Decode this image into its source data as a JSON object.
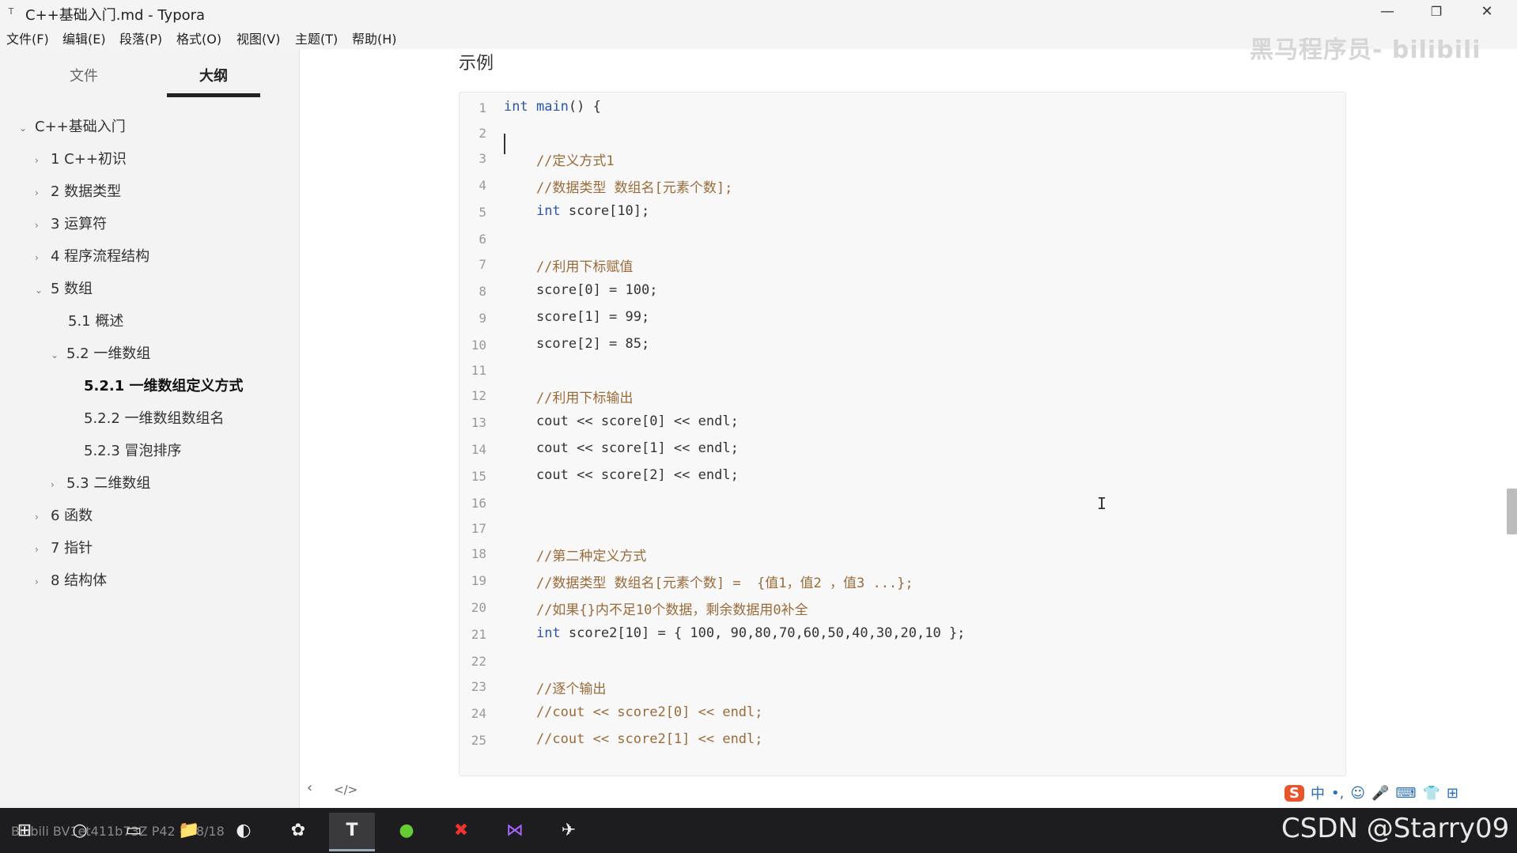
{
  "window": {
    "app_icon": "T",
    "title": "C++基础入门.md - Typora",
    "minimize": "—",
    "maximize": "❐",
    "close": "✕"
  },
  "menu": [
    "文件(F)",
    "编辑(E)",
    "段落(P)",
    "格式(O)",
    "视图(V)",
    "主题(T)",
    "帮助(H)"
  ],
  "sidebar": {
    "tabs": [
      "文件",
      "大纲"
    ],
    "toc": [
      {
        "label": "C++基础入门",
        "expanded": true
      },
      {
        "label": "1 C++初识",
        "expanded": false
      },
      {
        "label": "2 数据类型",
        "expanded": false
      },
      {
        "label": "3 运算符",
        "expanded": false
      },
      {
        "label": "4 程序流程结构",
        "expanded": false
      },
      {
        "label": "5 数组",
        "expanded": true
      },
      {
        "label": "5.1 概述"
      },
      {
        "label": "5.2 一维数组",
        "expanded": true
      },
      {
        "label": "5.2.1 一维数组定义方式",
        "active": true
      },
      {
        "label": "5.2.2 一维数组数组名"
      },
      {
        "label": "5.2.3 冒泡排序"
      },
      {
        "label": "5.3 二维数组",
        "expanded": false
      },
      {
        "label": "6 函数",
        "expanded": false
      },
      {
        "label": "7 指针",
        "expanded": false
      },
      {
        "label": "8 结构体",
        "expanded": false
      }
    ],
    "bottom_icons": [
      "‹",
      "</>"
    ]
  },
  "content": {
    "heading": "示例",
    "code_lines": [
      "int main() {",
      "",
      "    //定义方式1",
      "    //数据类型 数组名[元素个数];",
      "    int score[10];",
      "",
      "    //利用下标赋值",
      "    score[0] = 100;",
      "    score[1] = 99;",
      "    score[2] = 85;",
      "",
      "    //利用下标输出",
      "    cout << score[0] << endl;",
      "    cout << score[1] << endl;",
      "    cout << score[2] << endl;",
      "",
      "",
      "    //第二种定义方式",
      "    //数据类型 数组名[元素个数] =  {值1，值2 ，值3 ...};",
      "    //如果{}内不足10个数据，剩余数据用0补全",
      "    int score2[10] = { 100, 90,80,70,60,50,40,30,20,10 };",
      "",
      "    //逐个输出",
      "    //cout << score2[0] << endl;",
      "    //cout << score2[1] << endl;"
    ],
    "colors": {
      "keyword": "#2a56a5",
      "comment": "#9a6b3a",
      "number": "#1a7a4a",
      "text": "#333333"
    }
  },
  "overlay": {
    "watermark": "黑马程序员- bilibili",
    "ime": [
      "S",
      "中",
      "•,",
      "☺",
      "🎤",
      "⌨",
      "👕",
      "⊞"
    ],
    "csdn": "CSDN @Starry09"
  },
  "taskbar": {
    "items": [
      {
        "icon": "windows-start-icon",
        "glyph": "⊞"
      },
      {
        "icon": "search-icon",
        "glyph": "○"
      },
      {
        "icon": "task-view-icon",
        "glyph": "▭"
      },
      {
        "icon": "file-explorer-icon",
        "glyph": "📁"
      },
      {
        "icon": "edge-browser-icon",
        "glyph": "◐"
      },
      {
        "icon": "chat-app-icon",
        "glyph": "✿"
      },
      {
        "icon": "typora-icon",
        "glyph": "T",
        "active": true
      },
      {
        "icon": "green-app-icon",
        "glyph": "●"
      },
      {
        "icon": "xmind-icon",
        "glyph": "✖"
      },
      {
        "icon": "visual-studio-icon",
        "glyph": "⋈"
      },
      {
        "icon": "bird-app-icon",
        "glyph": "✈"
      }
    ],
    "left_text": "Bilibili BV1et411b73Z P42 - 58/18"
  }
}
